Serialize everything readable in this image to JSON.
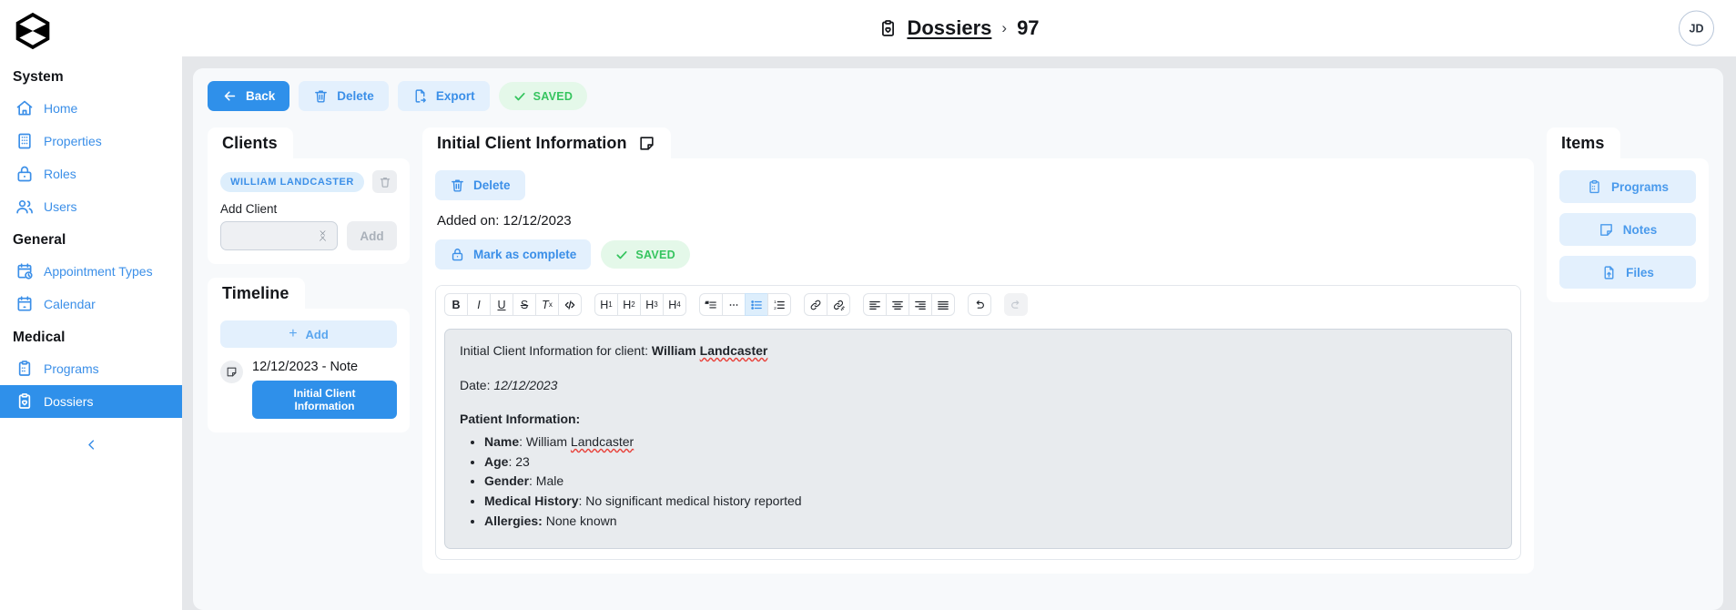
{
  "header": {
    "breadcrumb_icon": "clipboard-heart-icon",
    "breadcrumb_root": "Dossiers",
    "breadcrumb_separator": "›",
    "breadcrumb_current": "97",
    "avatar_initials": "JD"
  },
  "sidebar": {
    "logo": "hexagon-x-logo",
    "groups": [
      {
        "title": "System",
        "items": [
          {
            "label": "Home",
            "icon": "home-icon",
            "active": false
          },
          {
            "label": "Properties",
            "icon": "building-icon",
            "active": false
          },
          {
            "label": "Roles",
            "icon": "lock-icon",
            "active": false
          },
          {
            "label": "Users",
            "icon": "users-icon",
            "active": false
          }
        ]
      },
      {
        "title": "General",
        "items": [
          {
            "label": "Appointment Types",
            "icon": "calendar-clock-icon",
            "active": false
          },
          {
            "label": "Calendar",
            "icon": "calendar-icon",
            "active": false
          }
        ]
      },
      {
        "title": "Medical",
        "items": [
          {
            "label": "Programs",
            "icon": "clipboard-list-icon",
            "active": false
          },
          {
            "label": "Dossiers",
            "icon": "clipboard-heart-icon",
            "active": true
          }
        ]
      }
    ],
    "collapse_icon": "chevron-left-icon"
  },
  "toolbar": {
    "back_label": "Back",
    "delete_label": "Delete",
    "export_label": "Export",
    "saved_label": "SAVED"
  },
  "clients": {
    "title": "Clients",
    "chips": [
      "WILLIAM LANDCASTER"
    ],
    "delete_icon": "trash-icon",
    "add_client_label": "Add Client",
    "select_value": "",
    "add_button_label": "Add"
  },
  "timeline": {
    "title": "Timeline",
    "add_label": "Add",
    "entries": [
      {
        "icon": "note-icon",
        "date_label": "12/12/2023 - Note",
        "button_label": "Initial Client Information"
      }
    ]
  },
  "note": {
    "title": "Initial Client Information",
    "title_icon": "note-icon",
    "delete_label": "Delete",
    "added_on": "Added on: 12/12/2023",
    "mark_complete_label": "Mark as complete",
    "saved_label": "SAVED",
    "toolbar_groups": [
      {
        "buttons": [
          {
            "name": "bold-button",
            "glyph": "B",
            "state": "normal"
          },
          {
            "name": "italic-button",
            "glyph": "I",
            "state": "normal"
          },
          {
            "name": "underline-button",
            "glyph": "U",
            "state": "normal"
          },
          {
            "name": "strikethrough-button",
            "glyph": "S",
            "state": "normal"
          },
          {
            "name": "clear-format-button",
            "glyph": "Tx",
            "state": "normal"
          },
          {
            "name": "code-button",
            "glyph": "</>",
            "state": "normal"
          }
        ]
      },
      {
        "buttons": [
          {
            "name": "heading-1-button",
            "glyph": "H1",
            "state": "normal"
          },
          {
            "name": "heading-2-button",
            "glyph": "H2",
            "state": "normal"
          },
          {
            "name": "heading-3-button",
            "glyph": "H3",
            "state": "normal"
          },
          {
            "name": "heading-4-button",
            "glyph": "H4",
            "state": "normal"
          }
        ]
      },
      {
        "buttons": [
          {
            "name": "blockquote-button",
            "glyph": "quote",
            "state": "normal"
          },
          {
            "name": "horizontal-rule-button",
            "glyph": "dots",
            "state": "normal"
          },
          {
            "name": "bullet-list-button",
            "glyph": "ul",
            "state": "active"
          },
          {
            "name": "ordered-list-button",
            "glyph": "ol",
            "state": "normal"
          }
        ]
      },
      {
        "buttons": [
          {
            "name": "link-button",
            "glyph": "link",
            "state": "normal"
          },
          {
            "name": "unlink-button",
            "glyph": "unlink",
            "state": "normal"
          }
        ]
      },
      {
        "buttons": [
          {
            "name": "align-left-button",
            "glyph": "align-left",
            "state": "normal"
          },
          {
            "name": "align-center-button",
            "glyph": "align-center",
            "state": "normal"
          },
          {
            "name": "align-right-button",
            "glyph": "align-right",
            "state": "normal"
          },
          {
            "name": "align-justify-button",
            "glyph": "align-justify",
            "state": "normal"
          }
        ]
      },
      {
        "buttons": [
          {
            "name": "undo-button",
            "glyph": "undo",
            "state": "normal"
          }
        ]
      },
      {
        "buttons": [
          {
            "name": "redo-button",
            "glyph": "redo",
            "state": "disabled"
          }
        ]
      }
    ],
    "content": {
      "line1_prefix": "Initial Client Information for client: ",
      "line1_client": "William Landcaster",
      "line2_label": "Date: ",
      "line2_value": "12/12/2023",
      "section_heading": "Patient Information:",
      "bullets": [
        {
          "label": "Name",
          "sep": ": ",
          "value": "William Landcaster",
          "misspelled": "Landcaster"
        },
        {
          "label": "Age",
          "sep": ": ",
          "value": "23",
          "misspelled": ""
        },
        {
          "label": "Gender",
          "sep": ": ",
          "value": "Male",
          "misspelled": ""
        },
        {
          "label": "Medical History",
          "sep": ": ",
          "value": "No significant medical history reported",
          "misspelled": ""
        },
        {
          "label": "Allergies:",
          "sep": " ",
          "value": "None known",
          "misspelled": ""
        }
      ]
    }
  },
  "items": {
    "title": "Items",
    "buttons": [
      {
        "label": "Programs",
        "icon": "clipboard-list-icon"
      },
      {
        "label": "Notes",
        "icon": "note-icon"
      },
      {
        "label": "Files",
        "icon": "file-upload-icon"
      }
    ]
  },
  "colors": {
    "accent_blue": "#2f90ea",
    "soft_blue_bg": "#e3f0fd",
    "link_blue": "#3b8fe8",
    "success_green": "#35c45e",
    "success_bg": "#e4f8e9",
    "page_bg": "#e5e7ea",
    "panel_bg": "#f7f9fb",
    "editor_bg": "#e8ebee"
  }
}
